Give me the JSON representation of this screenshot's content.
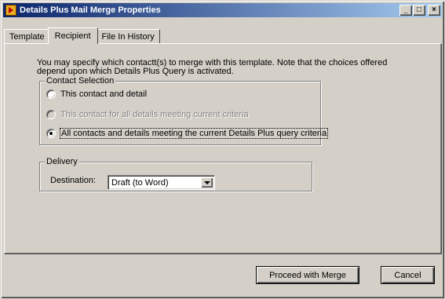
{
  "window": {
    "title": "Details Plus Mail Merge Properties",
    "minimize_label": "_",
    "maximize_label": "□",
    "close_label": "×"
  },
  "tabs": [
    {
      "label": "Template",
      "active": false
    },
    {
      "label": "Recipient",
      "active": true
    },
    {
      "label": "File In History",
      "active": false
    }
  ],
  "recipient": {
    "intro_line1": "You may specify which contactt(s) to merge with this template.  Note that the choices offered",
    "intro_line2": "depend upon which Details Plus Query is activated.",
    "contact_selection": {
      "label": "Contact Selection",
      "options": [
        {
          "label": "This contact and detail",
          "selected": false,
          "enabled": true
        },
        {
          "label": "This contact for all details meeting current criteria",
          "selected": false,
          "enabled": false
        },
        {
          "label": "All contacts and details meeting the current Details Plus query criteria",
          "selected": true,
          "enabled": true
        }
      ]
    },
    "delivery": {
      "label": "Delivery",
      "destination_label": "Destination:",
      "destination_value": "Draft (to Word)"
    }
  },
  "buttons": {
    "proceed": "Proceed with Merge",
    "cancel": "Cancel"
  },
  "colors": {
    "title_active": "#0a246a",
    "title_gradient_end": "#a6caf0",
    "face": "#d4d0c8"
  }
}
